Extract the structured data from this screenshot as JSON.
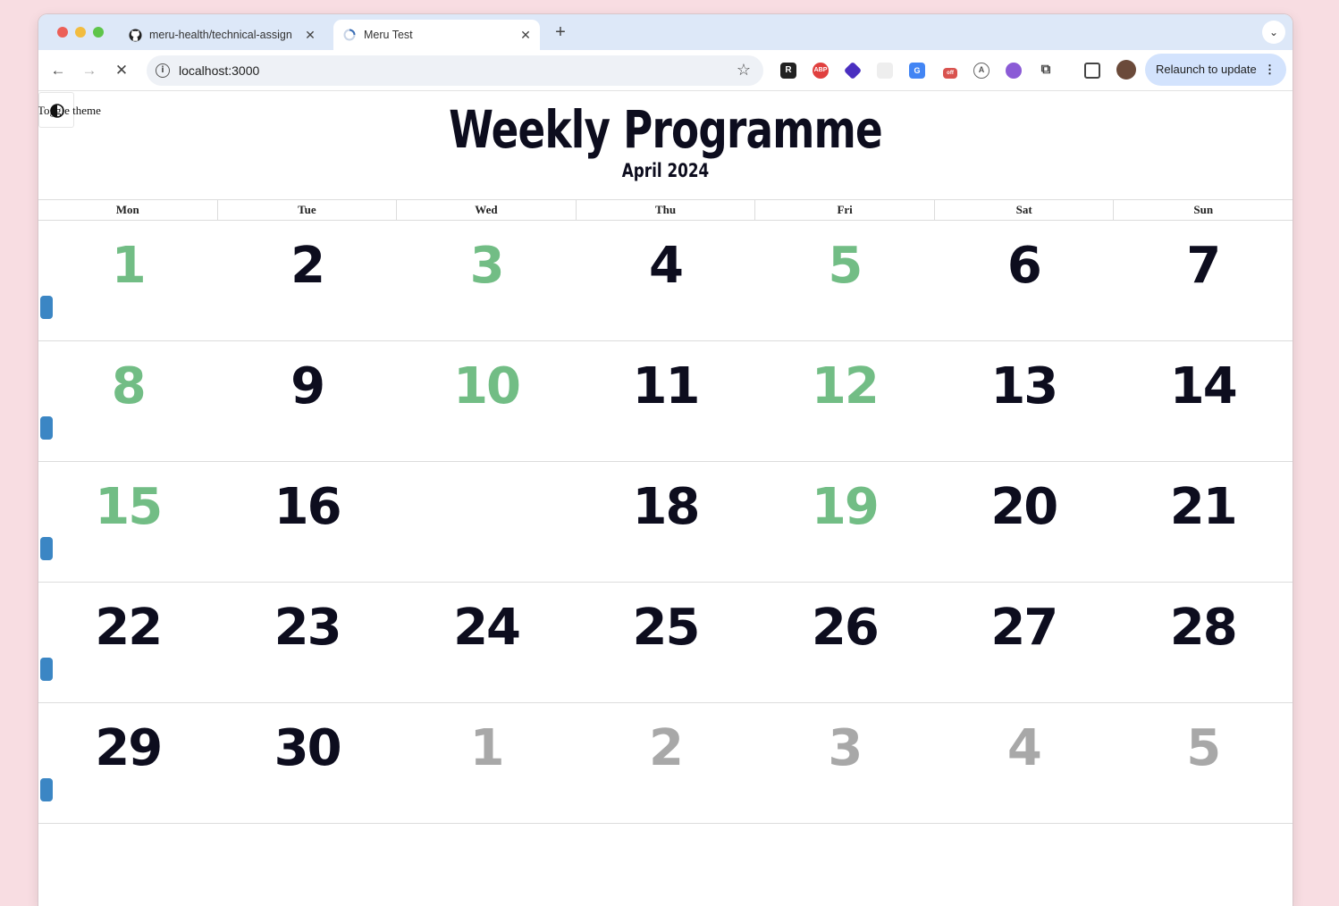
{
  "browser": {
    "tabs": [
      {
        "title": "meru-health/technical-assign",
        "close": "✕",
        "active": false
      },
      {
        "title": "Meru Test",
        "close": "✕",
        "active": true
      }
    ],
    "new_tab": "+",
    "url": "localhost:3000",
    "relaunch_label": "Relaunch to update"
  },
  "page": {
    "theme_toggle_label": "Toggle theme",
    "title": "Weekly Programme",
    "subtitle": "April 2024",
    "weekdays": [
      "Mon",
      "Tue",
      "Wed",
      "Thu",
      "Fri",
      "Sat",
      "Sun"
    ],
    "weeks": [
      [
        {
          "label": "1",
          "style": "green"
        },
        {
          "label": "2",
          "style": "dark"
        },
        {
          "label": "3",
          "style": "green"
        },
        {
          "label": "4",
          "style": "dark"
        },
        {
          "label": "5",
          "style": "green"
        },
        {
          "label": "6",
          "style": "dark"
        },
        {
          "label": "7",
          "style": "dark"
        }
      ],
      [
        {
          "label": "8",
          "style": "green"
        },
        {
          "label": "9",
          "style": "dark"
        },
        {
          "label": "10",
          "style": "green"
        },
        {
          "label": "11",
          "style": "dark"
        },
        {
          "label": "12",
          "style": "green"
        },
        {
          "label": "13",
          "style": "dark"
        },
        {
          "label": "14",
          "style": "dark"
        }
      ],
      [
        {
          "label": "15",
          "style": "green"
        },
        {
          "label": "16",
          "style": "dark"
        },
        {
          "label": "",
          "style": "dark"
        },
        {
          "label": "18",
          "style": "dark"
        },
        {
          "label": "19",
          "style": "green"
        },
        {
          "label": "20",
          "style": "dark"
        },
        {
          "label": "21",
          "style": "dark"
        }
      ],
      [
        {
          "label": "22",
          "style": "dark"
        },
        {
          "label": "23",
          "style": "dark"
        },
        {
          "label": "24",
          "style": "dark"
        },
        {
          "label": "25",
          "style": "dark"
        },
        {
          "label": "26",
          "style": "dark"
        },
        {
          "label": "27",
          "style": "dark"
        },
        {
          "label": "28",
          "style": "dark"
        }
      ],
      [
        {
          "label": "29",
          "style": "dark"
        },
        {
          "label": "30",
          "style": "dark"
        },
        {
          "label": "1",
          "style": "grey"
        },
        {
          "label": "2",
          "style": "grey"
        },
        {
          "label": "3",
          "style": "grey"
        },
        {
          "label": "4",
          "style": "grey"
        },
        {
          "label": "5",
          "style": "grey"
        }
      ]
    ]
  },
  "colors": {
    "completed_day": "#72bd85",
    "day": "#0d0d1e",
    "other_month_day": "#a8a8a8",
    "week_marker": "#3b86c4"
  }
}
